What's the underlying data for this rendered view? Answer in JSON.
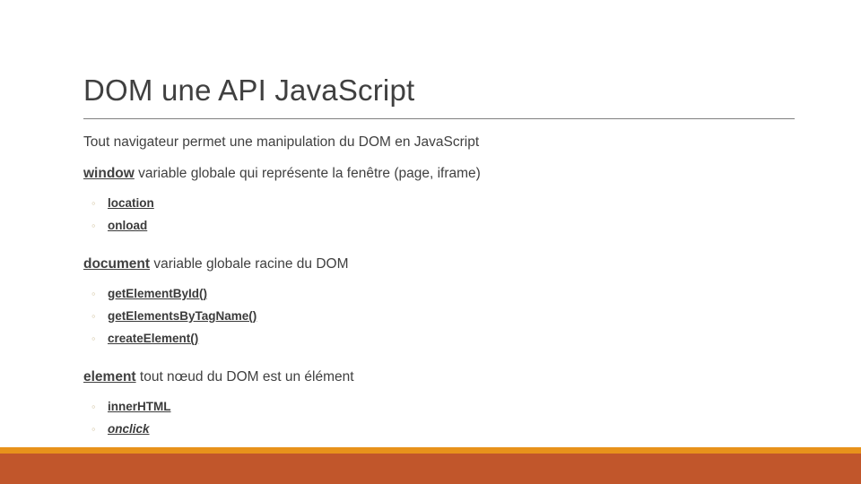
{
  "slide": {
    "title": "DOM une API JavaScript",
    "intro": "Tout navigateur permet une manipulation du DOM en JavaScript",
    "sections": [
      {
        "keyword": "window",
        "description": " variable globale qui représente la fenêtre (page, iframe)",
        "items": [
          {
            "label": "location",
            "marker": "hollow-circle-bullet",
            "italic": false
          },
          {
            "label": "onload",
            "marker": "hollow-circle-bullet",
            "italic": false
          }
        ]
      },
      {
        "keyword": "document",
        "description": " variable globale racine du DOM",
        "items": [
          {
            "label": "getElementById()",
            "marker": "hollow-circle-bullet",
            "italic": false
          },
          {
            "label": "getElementsByTagName()",
            "marker": "hollow-circle-bullet",
            "italic": false
          },
          {
            "label": "createElement()",
            "marker": "hollow-circle-bullet",
            "italic": false
          }
        ]
      },
      {
        "keyword": "element",
        "description": " tout nœud du DOM est un élément",
        "items": [
          {
            "label": "innerHTML",
            "marker": "hollow-circle-bullet",
            "italic": false
          },
          {
            "label": "onclick",
            "marker": "hollow-circle-bullet",
            "italic": true
          }
        ]
      }
    ],
    "bullet_glyph": "◦",
    "colors": {
      "title_text": "#404040",
      "body_text": "#404040",
      "rule": "#7f7f7f",
      "bullet_marker": "#d6c9a8",
      "accent_stripe": "#e8921b",
      "accent_band": "#c1562b",
      "background": "#ffffff"
    }
  }
}
